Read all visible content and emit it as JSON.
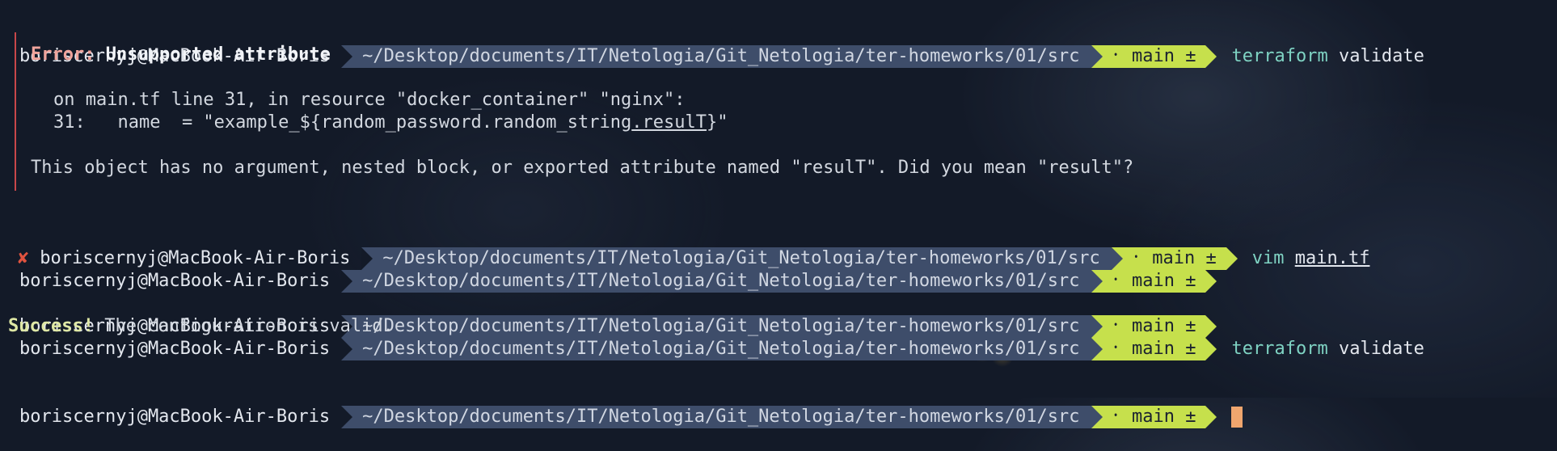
{
  "user_host": "boriscernyj@MacBook-Air-Boris",
  "path": "~/Desktop/documents/IT/Netologia/Git_Netologia/ter-homeworks/01/src",
  "git_branch": "main ±",
  "git_icon": "git-branch-icon",
  "error_mark": "✘",
  "error": {
    "label": "Error:",
    "title": "Unsupported attribute",
    "location": "on main.tf line 31, in resource \"docker_container\" \"nginx\":",
    "code_prefix": "31:   name  = \"example_${random_password.random_string",
    "code_highlight": ".resulT",
    "code_suffix": "}\"",
    "message": "This object has no argument, nested block, or exported attribute named \"resulT\". Did you mean \"result\"?"
  },
  "commands": {
    "first": {
      "name": "terraform",
      "arg": "validate"
    },
    "vim": {
      "name": "vim",
      "arg": "main.tf"
    },
    "second": {
      "name": "terraform",
      "arg": "validate"
    }
  },
  "success": {
    "label": "Success!",
    "message": " The configuration is valid."
  },
  "colors": {
    "background": "#131a28",
    "path_segment": "#3e4d6a",
    "git_segment": "#c6e04c",
    "command": "#7fd3c3",
    "error_bar": "#c8474a",
    "cursor": "#f0a66e"
  }
}
